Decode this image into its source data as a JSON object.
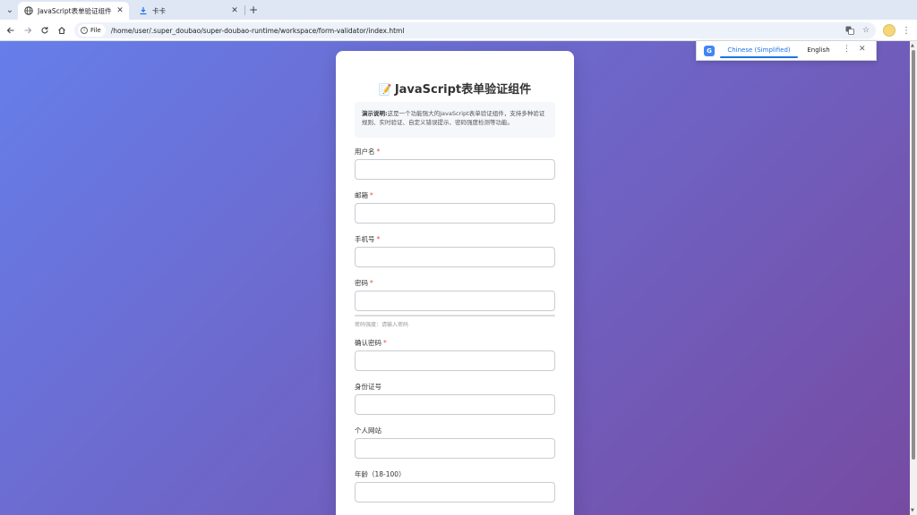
{
  "browser": {
    "tabs": [
      {
        "title": "JavaScript表单验证组件",
        "icon": "globe-icon",
        "active": true
      },
      {
        "title": "卡卡",
        "icon": "download-icon",
        "active": false
      }
    ],
    "site_chip": "File",
    "url": "/home/user/.super_doubao/super-doubao-runtime/workspace/form-validator/index.html"
  },
  "translate": {
    "active_language": "Chinese (Simplified)",
    "other_language": "English"
  },
  "page": {
    "title": "JavaScript表单验证组件",
    "title_emoji": "📝",
    "notice_label": "演示说明:",
    "notice_text": "这是一个功能强大的JavaScript表单验证组件，支持多种验证规则、实时验证、自定义错误提示、密码强度检测等功能。",
    "fields": [
      {
        "label": "用户名",
        "required": "*"
      },
      {
        "label": "邮箱",
        "required": "*"
      },
      {
        "label": "手机号",
        "required": "*"
      },
      {
        "label": "密码",
        "required": "*"
      },
      {
        "label": "确认密码",
        "required": "*"
      },
      {
        "label": "身份证号",
        "required": ""
      },
      {
        "label": "个人网站",
        "required": ""
      },
      {
        "label": "年龄（18-100）",
        "required": ""
      }
    ],
    "strength_text": "密码强度：请输入密码"
  },
  "colors": {
    "gradient_start": "#667eea",
    "gradient_end": "#764ba2",
    "required": "#e74c3c",
    "accent": "#1a73e8"
  }
}
